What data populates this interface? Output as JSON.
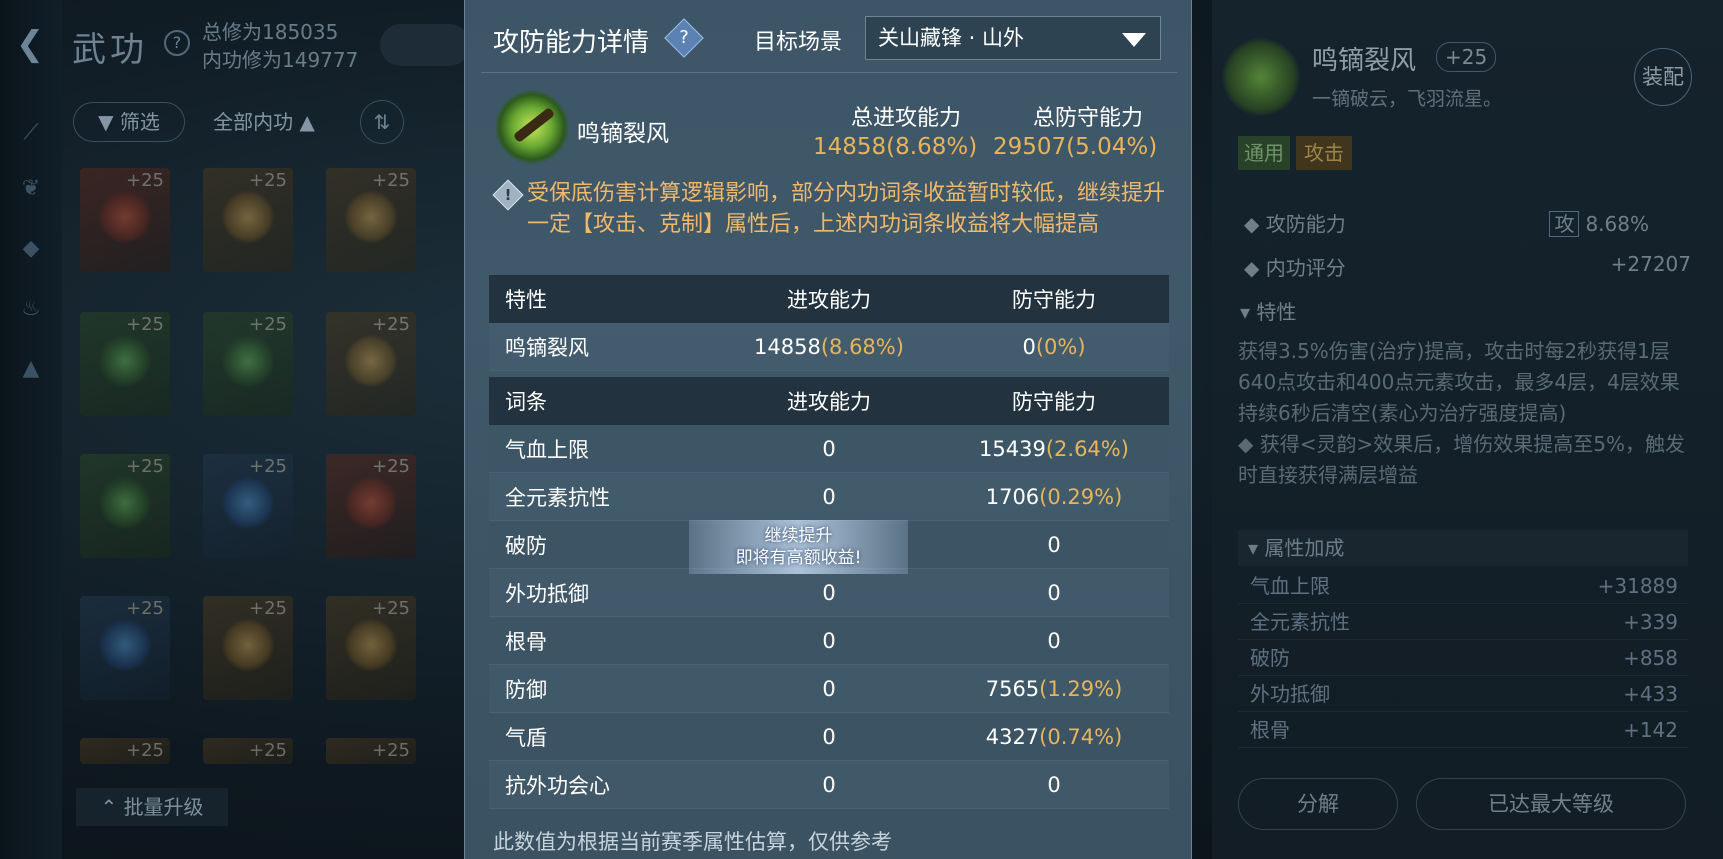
{
  "background": {
    "title": "武功",
    "cultivation_total": "总修为185035",
    "cultivation_inner": "内功修为149777",
    "filter_label": "筛选",
    "category_label": "全部内功",
    "batch_upgrade_label": "批量升级",
    "card_plus": "+25",
    "right_panel": {
      "skill_name": "鸣镝裂风",
      "level": "+25",
      "subtitle": "一镝破云，飞羽流星。",
      "equip_label": "装配",
      "tag_general": "通用",
      "tag_attack": "攻击",
      "power_label": "攻防能力",
      "power_tag": "攻",
      "power_value": "8.68%",
      "score_label": "内功评分",
      "score_value": "+27207",
      "trait_section": "特性",
      "trait_text": "获得3.5%伤害(治疗)提高，攻击时每2秒获得1层640点攻击和400点元素攻击，最多4层，4层效果持续6秒后清空(素心为治疗强度提高)",
      "trait_text_2": "◆ 获得<灵韵>效果后，增伤效果提高至5%，触发时直接获得满层增益",
      "attr_section": "属性加成",
      "attrs": [
        {
          "name": "气血上限",
          "value": "+31889"
        },
        {
          "name": "全元素抗性",
          "value": "+339"
        },
        {
          "name": "破防",
          "value": "+858"
        },
        {
          "name": "外功抵御",
          "value": "+433"
        },
        {
          "name": "根骨",
          "value": "+142"
        }
      ],
      "decompose_label": "分解",
      "maxlevel_label": "已达最大等级"
    }
  },
  "modal": {
    "title": "攻防能力详情",
    "help_glyph": "?",
    "scene_label": "目标场景",
    "scene_value": "关山藏锋 · 山外",
    "skill_name": "鸣镝裂风",
    "total_attack_label": "总进攻能力",
    "total_attack_value": "14858(8.68%)",
    "total_defense_label": "总防守能力",
    "total_defense_value": "29507(5.04%)",
    "notice_glyph": "!",
    "notice": "受保底伤害计算逻辑影响，部分内功词条收益暂时较低，继续提升一定【攻击、克制】属性后，上述内功词条收益将大幅提高",
    "trait_table": {
      "headers": [
        "特性",
        "进攻能力",
        "防守能力"
      ],
      "rows": [
        {
          "name": "鸣镝裂风",
          "atk": "14858",
          "atk_pct": "(8.68%)",
          "def": "0",
          "def_pct": "(0%)"
        }
      ]
    },
    "entry_table": {
      "headers": [
        "词条",
        "进攻能力",
        "防守能力"
      ],
      "rows": [
        {
          "name": "气血上限",
          "atk": "0",
          "def": "15439",
          "def_pct": "(2.64%)"
        },
        {
          "name": "全元素抗性",
          "atk": "0",
          "def": "1706",
          "def_pct": "(0.29%)"
        },
        {
          "name": "破防",
          "atk": "",
          "def": "0",
          "def_pct": ""
        },
        {
          "name": "外功抵御",
          "atk": "0",
          "def": "0",
          "def_pct": ""
        },
        {
          "name": "根骨",
          "atk": "0",
          "def": "0",
          "def_pct": ""
        },
        {
          "name": "防御",
          "atk": "0",
          "def": "7565",
          "def_pct": "(1.29%)"
        },
        {
          "name": "气盾",
          "atk": "0",
          "def": "4327",
          "def_pct": "(0.74%)"
        },
        {
          "name": "抗外功会心",
          "atk": "0",
          "def": "0",
          "def_pct": ""
        }
      ]
    },
    "promo_line1": "继续提升",
    "promo_line2": "即将有高额收益!",
    "footer": "此数值为根据当前赛季属性估算，仅供参考"
  }
}
